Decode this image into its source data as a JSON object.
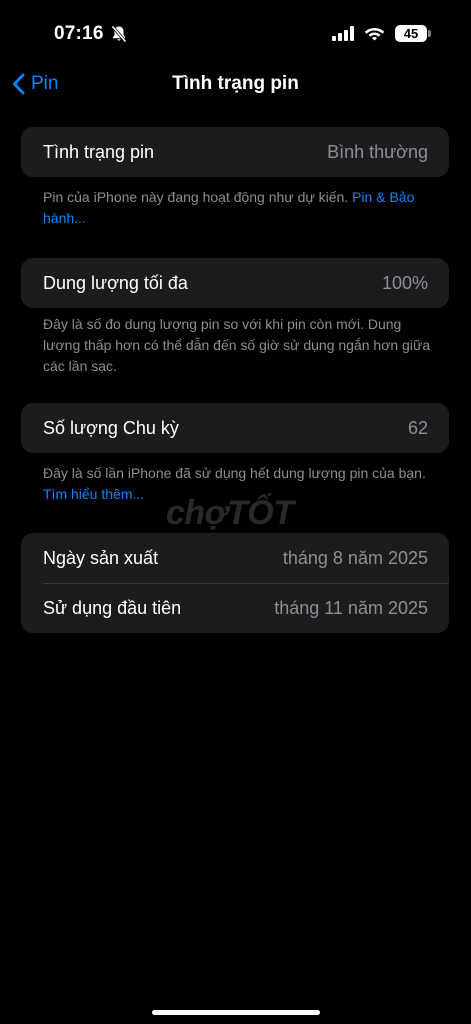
{
  "status_bar": {
    "time": "07:16",
    "battery_level": "45"
  },
  "nav": {
    "back_label": "Pin",
    "title": "Tình trạng pin"
  },
  "health": {
    "label": "Tình trạng pin",
    "value": "Bình thường",
    "footnote": "Pin của iPhone này đang hoạt động như dự kiến.",
    "footnote_link": "Pin & Bảo hành..."
  },
  "capacity": {
    "label": "Dung lượng tối đa",
    "value": "100%",
    "footnote": "Đây là số đo dung lượng pin so với khi pin còn mới. Dung lượng thấp hơn có thể dẫn đến số giờ sử dụng ngắn hơn giữa các lần sạc."
  },
  "cycles": {
    "label": "Số lượng Chu kỳ",
    "value": "62",
    "footnote": "Đây là số lần iPhone đã sử dụng hết dung lượng pin của bạn.",
    "footnote_link": "Tìm hiểu thêm..."
  },
  "dates": {
    "manufacture_label": "Ngày sản xuất",
    "manufacture_value": "tháng 8 năm 2025",
    "first_use_label": "Sử dụng đầu tiên",
    "first_use_value": "tháng 11 năm 2025"
  },
  "watermark": "chợTỐT",
  "colors": {
    "accent": "#0a84ff",
    "background": "#000000",
    "cell": "#1c1c1e",
    "secondary_text": "#8e8e93"
  }
}
